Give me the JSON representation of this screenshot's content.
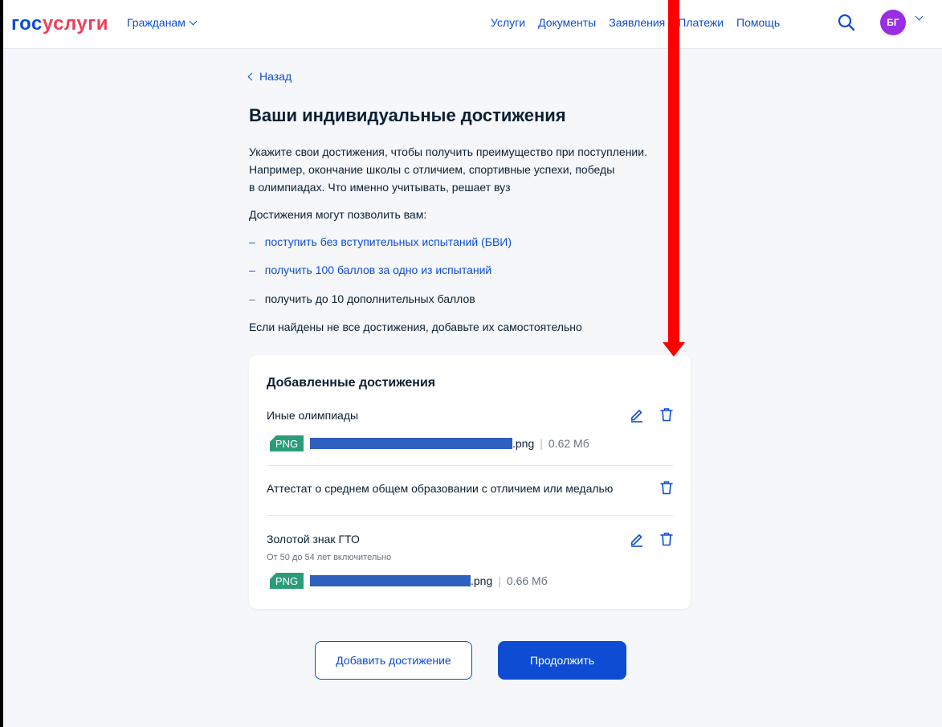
{
  "header": {
    "logo_part1": "гос",
    "logo_part2": "услуги",
    "audience": "Гражданам",
    "nav": [
      "Услуги",
      "Документы",
      "Заявления",
      "Платежи",
      "Помощь"
    ],
    "avatar_initials": "БГ"
  },
  "back_label": "Назад",
  "title": "Ваши индивидуальные достижения",
  "description_lines": [
    "Укажите свои достижения, чтобы получить преимущество при поступлении.",
    "Например, окончание школы с отличием, спортивные успехи, победы",
    "в олимпиадах. Что именно учитывать, решает вуз"
  ],
  "benefits_lead": "Достижения могут позволить вам:",
  "benefits": [
    {
      "dash": "–",
      "text": "поступить без вступительных испытаний (БВИ)",
      "link": true
    },
    {
      "dash": "–",
      "text": "получить 100 баллов за одно из испытаний",
      "link": true
    },
    {
      "dash": "–",
      "text": "получить до 10 дополнительных баллов",
      "link": false
    }
  ],
  "note": "Если найдены не все достижения, добавьте их самостоятельно",
  "card": {
    "title": "Добавленные достижения",
    "items": [
      {
        "title": "Иные олимпиады",
        "file": {
          "badge": "PNG",
          "ext": ".png",
          "sep": "|",
          "size": "0.62 Мб"
        }
      },
      {
        "title": "Аттестат о среднем общем образовании с отличием или медалью"
      },
      {
        "title": "Золотой знак ГТО",
        "subtitle": "От 50 до 54 лет включительно",
        "file": {
          "badge": "PNG",
          "ext": ".png",
          "sep": "|",
          "size": "0.66 Мб"
        }
      }
    ]
  },
  "buttons": {
    "add": "Добавить достижение",
    "continue": "Продолжить"
  },
  "colors": {
    "accent": "#0d4cd3",
    "logo_red": "#ee3f58",
    "badge": "#2a9d78",
    "annotation_arrow": "#ff0000"
  }
}
